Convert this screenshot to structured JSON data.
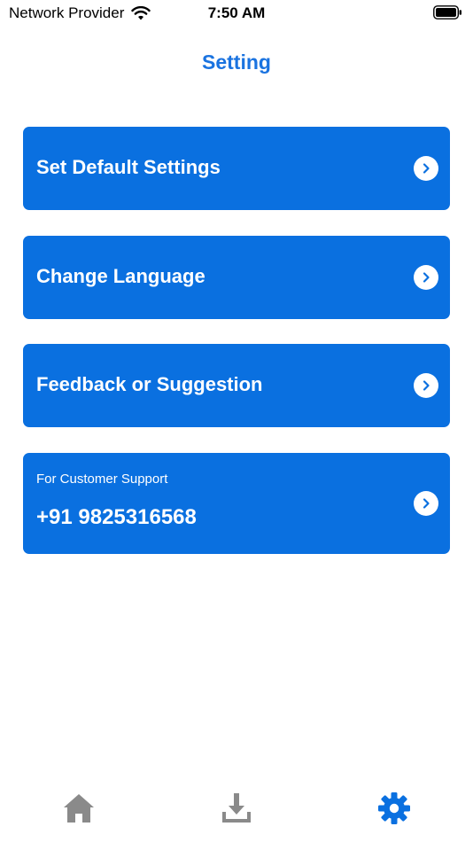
{
  "status_bar": {
    "carrier": "Network Provider",
    "time": "7:50 AM",
    "wifi_icon": "wifi-icon",
    "battery_icon": "battery-icon"
  },
  "header": {
    "title": "Setting"
  },
  "menu": {
    "items": [
      {
        "label": "Set Default Settings",
        "icon": "chevron-right-icon"
      },
      {
        "label": "Change Language",
        "icon": "chevron-right-icon"
      },
      {
        "label": "Feedback or Suggestion",
        "icon": "chevron-right-icon"
      }
    ],
    "support": {
      "caption": "For Customer Support",
      "phone": "+91 9825316568",
      "icon": "chevron-right-icon"
    }
  },
  "tab_bar": {
    "tabs": [
      {
        "name": "home",
        "icon": "home-icon",
        "active": false
      },
      {
        "name": "download",
        "icon": "download-icon",
        "active": false
      },
      {
        "name": "settings",
        "icon": "gear-icon",
        "active": true
      }
    ]
  },
  "colors": {
    "accent": "#0a70e0",
    "title": "#1a73e0",
    "inactive_tab": "#8a8a8a",
    "active_tab": "#0a70e0",
    "card_text": "#ffffff"
  }
}
